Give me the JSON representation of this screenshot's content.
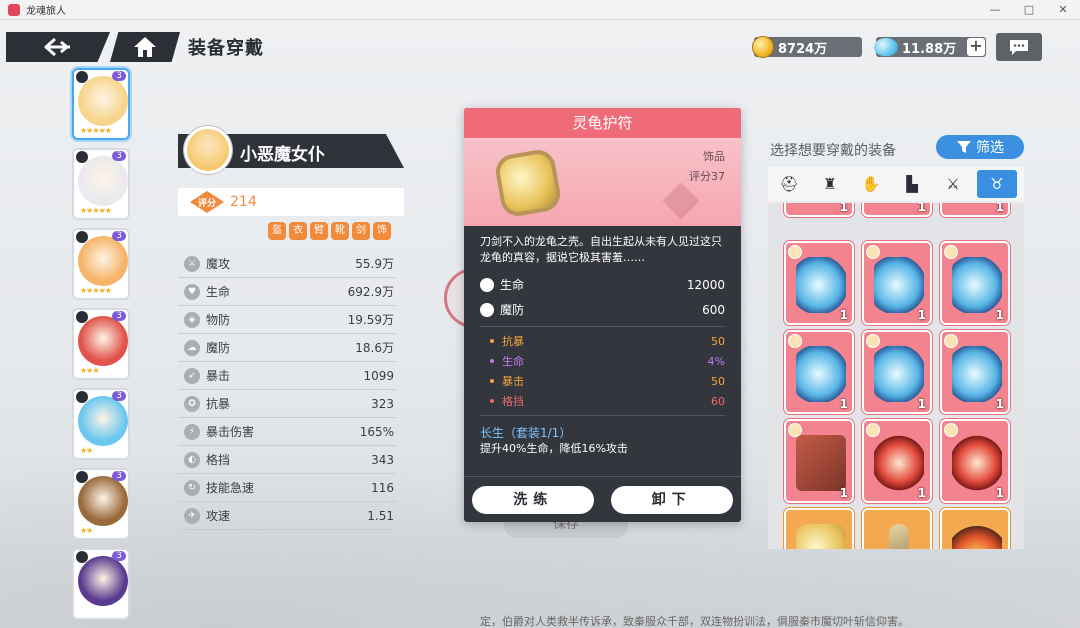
{
  "window": {
    "title": "龙魂旅人",
    "controls": [
      "—",
      "□",
      "✕"
    ]
  },
  "header": {
    "title": "装备穿戴",
    "gold": "8724万",
    "gems": "11.88万",
    "plus": "+"
  },
  "character": {
    "name": "小恶魔女仆",
    "score_label": "评分",
    "score": "214",
    "slot_icons": [
      "盔",
      "衣",
      "臂",
      "靴",
      "剑",
      "饰"
    ],
    "stats": [
      {
        "name": "魔攻",
        "value": "55.9万"
      },
      {
        "name": "生命",
        "value": "692.9万"
      },
      {
        "name": "物防",
        "value": "19.59万"
      },
      {
        "name": "魔防",
        "value": "18.6万"
      },
      {
        "name": "暴击",
        "value": "1099"
      },
      {
        "name": "抗暴",
        "value": "323"
      },
      {
        "name": "暴击伤害",
        "value": "165%"
      },
      {
        "name": "格挡",
        "value": "343"
      },
      {
        "name": "技能急速",
        "value": "116"
      },
      {
        "name": "攻速",
        "value": "1.51"
      }
    ]
  },
  "roster": [
    {
      "level": "3",
      "stars": "★★★★★",
      "face": "#f6d58c",
      "selected": true
    },
    {
      "level": "3",
      "stars": "★★★★★",
      "face": "#e9e9ee",
      "selected": false
    },
    {
      "level": "3",
      "stars": "★★★★★",
      "face": "#f6b46a",
      "selected": false
    },
    {
      "level": "3",
      "stars": "★★★",
      "face": "#e0534a",
      "selected": false
    },
    {
      "level": "3",
      "stars": "★★",
      "face": "#6cc7ef",
      "selected": false
    },
    {
      "level": "3",
      "stars": "★★",
      "face": "#9a6a3c",
      "selected": false
    },
    {
      "level": "3",
      "stars": "",
      "face": "#5a3b8f",
      "selected": false
    }
  ],
  "item": {
    "name": "灵龟护符",
    "type": "饰品",
    "score": "评分37",
    "description": "刀剑不入的龙龟之壳。自出生起从未有人见过这只龙龟的真容，据说它极其害羞……",
    "main_stats": [
      {
        "name": "生命",
        "value": "12000"
      },
      {
        "name": "魔防",
        "value": "600"
      }
    ],
    "sub_stats": [
      {
        "name": "抗暴",
        "value": "50",
        "color": "#f3a73b"
      },
      {
        "name": "生命",
        "value": "4%",
        "color": "#c07cf0"
      },
      {
        "name": "暴击",
        "value": "50",
        "color": "#f3a73b"
      },
      {
        "name": "格挡",
        "value": "60",
        "color": "#ee6a6a"
      }
    ],
    "set_title": "长生（套装1/1）",
    "set_desc": "提升40%生命，降低16%攻击",
    "btn_reforge": "洗练",
    "btn_unequip": "卸下"
  },
  "equipment": {
    "prompt": "选择想要穿戴的装备",
    "filter_label": "筛选",
    "tabs": [
      "⛑",
      "♜",
      "✋",
      "▙",
      "⚔",
      "♉"
    ],
    "items": [
      {
        "count": "1",
        "art": "water",
        "frame": "pink"
      },
      {
        "count": "1",
        "art": "water",
        "frame": "pink"
      },
      {
        "count": "1",
        "art": "water",
        "frame": "pink"
      },
      {
        "count": "1",
        "art": "water",
        "frame": "pink"
      },
      {
        "count": "1",
        "art": "water",
        "frame": "pink"
      },
      {
        "count": "1",
        "art": "water",
        "frame": "pink"
      },
      {
        "count": "1",
        "art": "book",
        "frame": "pink"
      },
      {
        "count": "1",
        "art": "flower",
        "frame": "pink"
      },
      {
        "count": "1",
        "art": "flower",
        "frame": "pink"
      },
      {
        "count": "",
        "art": "shell",
        "frame": "gold"
      },
      {
        "count": "",
        "art": "wand",
        "frame": "gold"
      },
      {
        "count": "",
        "art": "fire",
        "frame": "gold"
      }
    ],
    "top_counts": [
      "1",
      "1",
      "1"
    ]
  },
  "background": {
    "save_label": "保存",
    "bottom_text": "定，伯爵对人类救半传诉承，致秦服众千部，双连物扮训法，俱服秦市魔切叶斩信仰害。"
  }
}
